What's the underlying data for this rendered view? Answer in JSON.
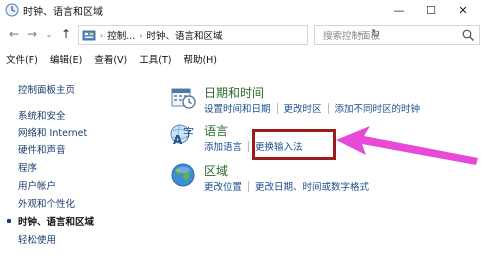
{
  "window": {
    "title": "时钟、语言和区域",
    "min_glyph": "—",
    "max_glyph": "☐",
    "close_glyph": "✕"
  },
  "nav": {
    "back_glyph": "←",
    "forward_glyph": "→",
    "recent_glyph": "⌄",
    "up_glyph": "↑"
  },
  "address": {
    "crumbs": [
      "控制...",
      "时钟、语言和区域"
    ],
    "sep_glyph": "›",
    "dropdown_glyph": "⌄",
    "refresh_glyph": "↻"
  },
  "search": {
    "placeholder": "搜索控制面板"
  },
  "menu": [
    "文件(F)",
    "编辑(E)",
    "查看(V)",
    "工具(T)",
    "帮助(H)"
  ],
  "sidebar": {
    "home": "控制面板主页",
    "items": [
      "系统和安全",
      "网络和 Internet",
      "硬件和声音",
      "程序",
      "用户帐户",
      "外观和个性化",
      "时钟、语言和区域",
      "轻松使用"
    ],
    "current_index": 6
  },
  "categories": [
    {
      "title": "日期和时间",
      "icon": "calendar-clock-icon",
      "links": [
        "设置时间和日期",
        "更改时区",
        "添加不同时区的时钟"
      ]
    },
    {
      "title": "语言",
      "icon": "language-icon",
      "links": [
        "添加语言",
        "更换输入法"
      ]
    },
    {
      "title": "区域",
      "icon": "region-globe-icon",
      "links": [
        "更改位置",
        "更改日期、时间或数字格式"
      ]
    }
  ],
  "annotation": {
    "box_color": "#9c1b1b",
    "arrow_color": "#e64ad6"
  }
}
